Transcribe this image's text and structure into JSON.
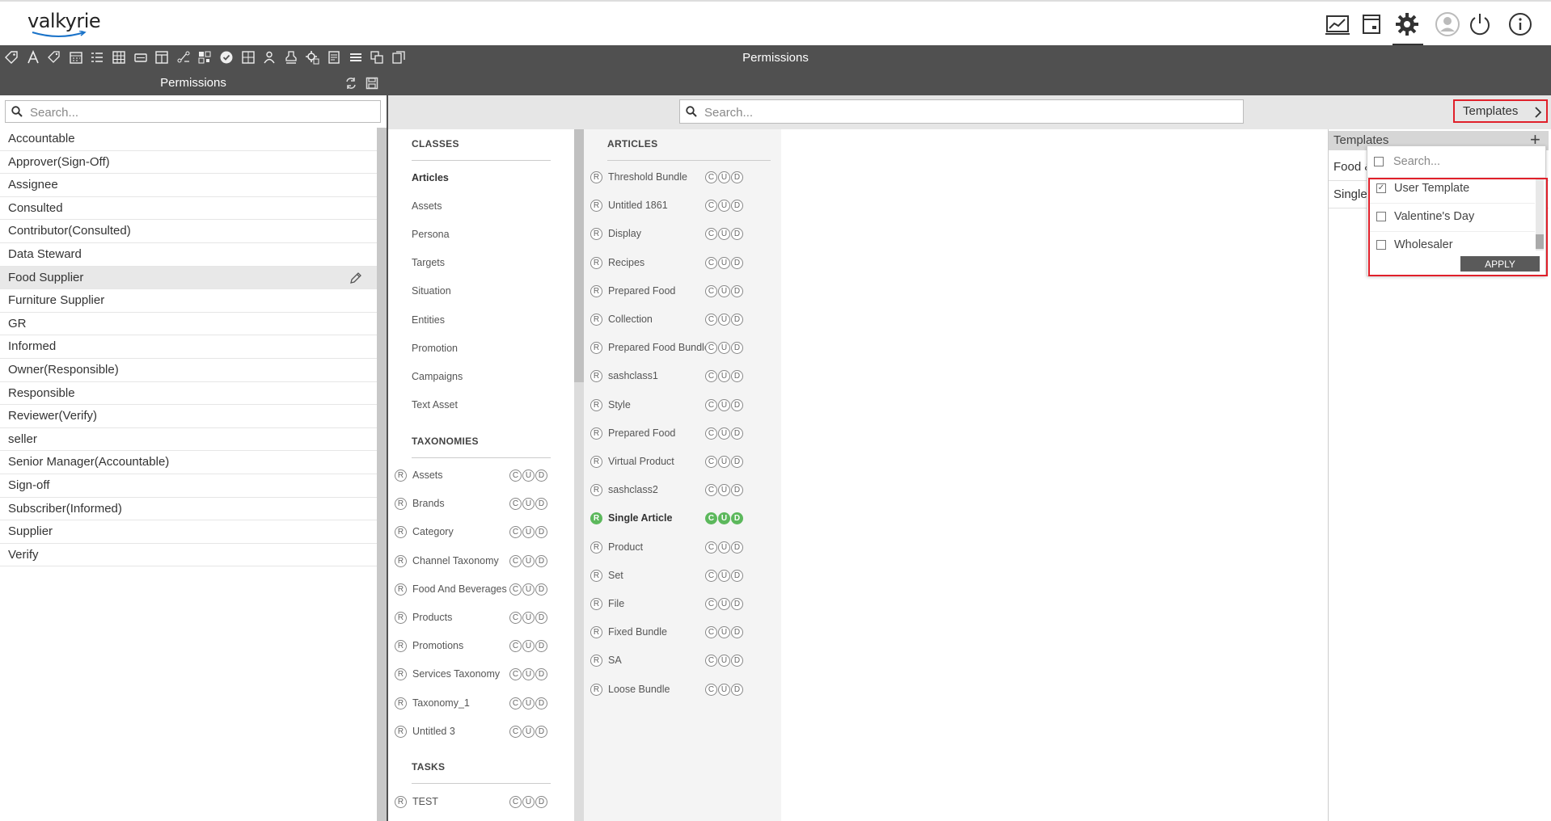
{
  "app": {
    "logo": "valkyrie",
    "title": "Permissions"
  },
  "header_icons": [
    "dashboard-chart-icon",
    "calendar-box-icon",
    "settings-gear-icon",
    "user-avatar-icon",
    "power-icon",
    "info-icon"
  ],
  "toolbar_icons": [
    "tag-icon",
    "text-attribute-icon",
    "tags-icon",
    "calendar-icon",
    "checklist-icon",
    "table-icon",
    "card-icon",
    "layout-icon",
    "workflow-icon",
    "qr-icon",
    "check-circle-icon",
    "grid-icon",
    "person-icon",
    "stamp-icon",
    "gear-doc-icon",
    "report-icon",
    "list-icon",
    "copy-icon",
    "export-icon"
  ],
  "left": {
    "title": "Permissions",
    "search_placeholder": "Search...",
    "roles": [
      "Accountable",
      "Approver(Sign-Off)",
      "Assignee",
      "Consulted",
      "Contributor(Consulted)",
      "Data Steward",
      "Food Supplier",
      "Furniture Supplier",
      "GR",
      "Informed",
      "Owner(Responsible)",
      "Responsible",
      "Reviewer(Verify)",
      "seller",
      "Senior Manager(Accountable)",
      "Sign-off",
      "Subscriber(Informed)",
      "Supplier",
      "Verify"
    ],
    "selected_role": "Food Supplier"
  },
  "main": {
    "search_placeholder": "Search...",
    "templates_button": "Templates"
  },
  "classes": {
    "title": "CLASSES",
    "items": [
      "Articles",
      "Assets",
      "Persona",
      "Targets",
      "Situation",
      "Entities",
      "Promotion",
      "Campaigns",
      "Text Asset"
    ],
    "selected": "Articles"
  },
  "taxonomies": {
    "title": "TAXONOMIES",
    "items": [
      "Assets",
      "Brands",
      "Category",
      "Channel Taxonomy",
      "Food And Beverages",
      "Products",
      "Promotions",
      "Services Taxonomy",
      "Taxonomy_1",
      "Untitled 3"
    ]
  },
  "tasks": {
    "title": "TASKS",
    "items": [
      "TEST"
    ]
  },
  "articles": {
    "title": "ARTICLES",
    "items": [
      "Threshold Bundle",
      "Untitled 1861",
      "Display",
      "Recipes",
      "Prepared Food",
      "Collection",
      "Prepared Food Bundle",
      "sashclass1",
      "Style",
      "Prepared Food",
      "Virtual Product",
      "sashclass2",
      "Single Article",
      "Product",
      "Set",
      "File",
      "Fixed Bundle",
      "SA",
      "Loose Bundle"
    ],
    "active": "Single Article"
  },
  "perm_letters": {
    "r": "R",
    "c": "C",
    "u": "U",
    "d": "D"
  },
  "templates_panel": {
    "title": "Templates",
    "add": "+",
    "rows": [
      "Food &",
      "Single"
    ],
    "dropdown": {
      "search_placeholder": "Search...",
      "options": [
        {
          "label": "User Template",
          "checked": true
        },
        {
          "label": "Valentine's Day",
          "checked": false
        },
        {
          "label": "Wholesaler",
          "checked": false
        }
      ],
      "apply": "APPLY"
    }
  },
  "colors": {
    "dark_bar": "#505050",
    "active_green": "#5cb85c",
    "highlight_red": "#e0202a"
  }
}
